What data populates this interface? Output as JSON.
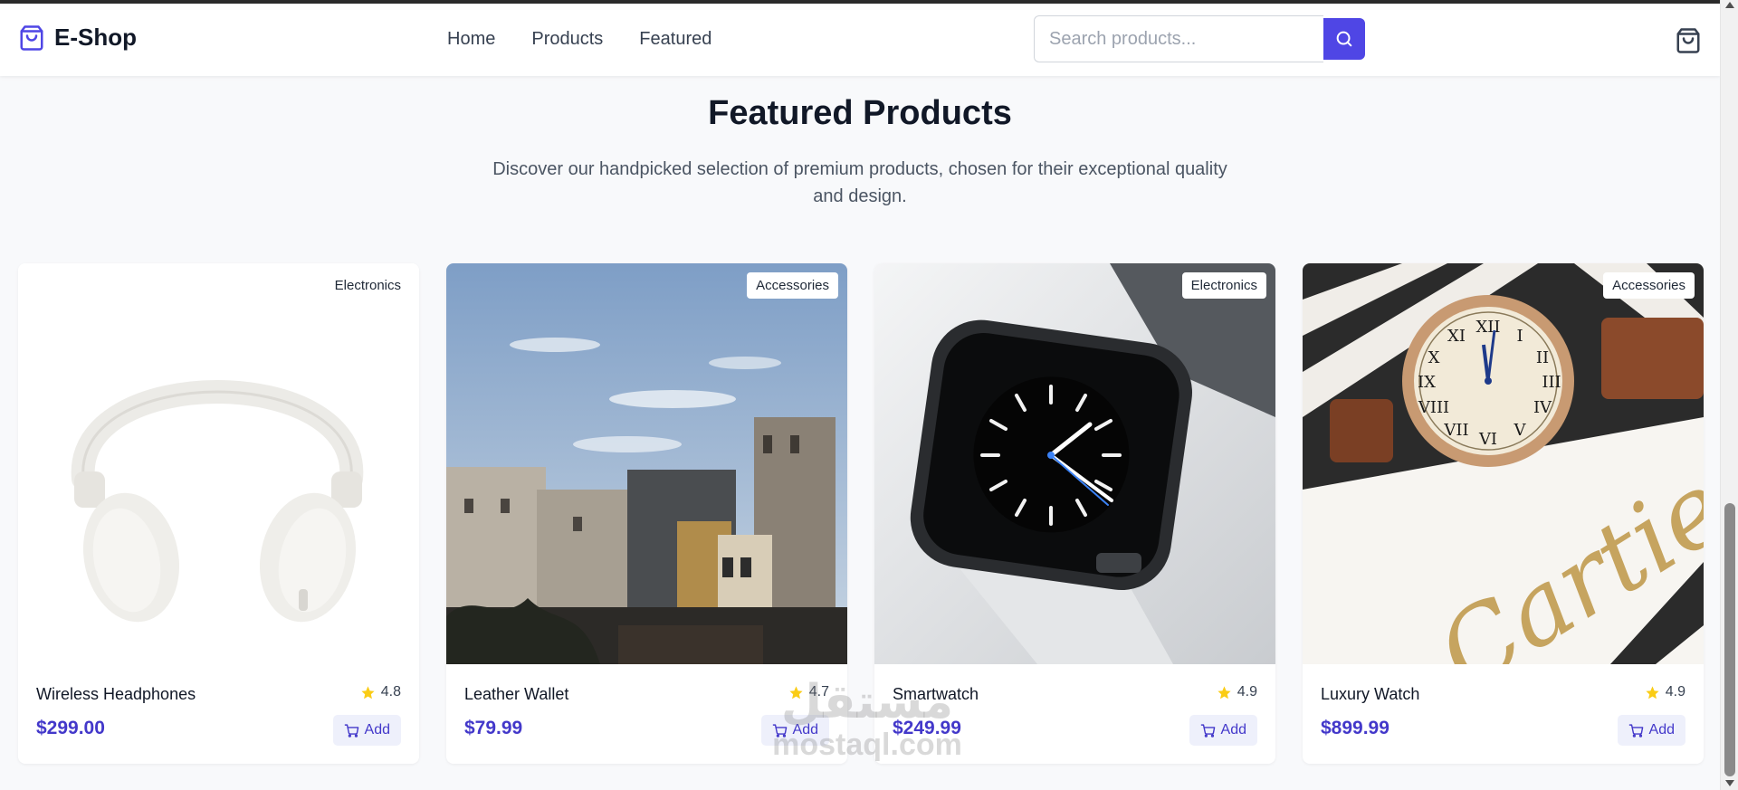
{
  "app": {
    "brand": "E-Shop"
  },
  "nav": {
    "items": [
      "Home",
      "Products",
      "Featured"
    ]
  },
  "search": {
    "placeholder": "Search products..."
  },
  "section": {
    "title": "Featured Products",
    "subtitle": "Discover our handpicked selection of premium products, chosen for their exceptional quality and design."
  },
  "products": [
    {
      "name": "Wireless Headphones",
      "category": "Electronics",
      "rating": "4.8",
      "price": "$299.00",
      "add_label": "Add"
    },
    {
      "name": "Leather Wallet",
      "category": "Accessories",
      "rating": "4.7",
      "price": "$79.99",
      "add_label": "Add"
    },
    {
      "name": "Smartwatch",
      "category": "Electronics",
      "rating": "4.9",
      "price": "$249.99",
      "add_label": "Add"
    },
    {
      "name": "Luxury Watch",
      "category": "Accessories",
      "rating": "4.9",
      "price": "$899.99",
      "add_label": "Add"
    }
  ],
  "watermark": {
    "arabic": "مستقل",
    "latin": "mostaql.com"
  },
  "colors": {
    "accent": "#4f46e5",
    "price": "#4338ca",
    "star": "#facc15"
  },
  "icons": [
    "shopping-bag-icon",
    "search-icon",
    "cart-icon",
    "star-icon",
    "shopping-cart-icon"
  ]
}
